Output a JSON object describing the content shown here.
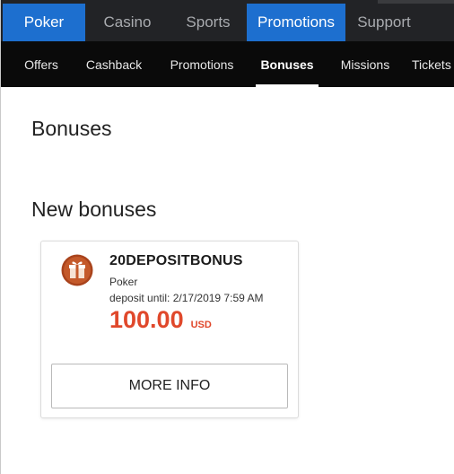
{
  "topnav": {
    "tabs": [
      {
        "label": "Poker",
        "active": true
      },
      {
        "label": "Casino",
        "active": false
      },
      {
        "label": "Sports",
        "active": false
      },
      {
        "label": "Promotions",
        "active": true
      },
      {
        "label": "Support",
        "active": false
      }
    ]
  },
  "subnav": {
    "items": [
      {
        "label": "Offers",
        "active": false
      },
      {
        "label": "Cashback",
        "active": false
      },
      {
        "label": "Promotions",
        "active": false
      },
      {
        "label": "Bonuses",
        "active": true
      },
      {
        "label": "Missions",
        "active": false
      },
      {
        "label": "Tickets",
        "active": false
      }
    ]
  },
  "page": {
    "title": "Bonuses",
    "section_title": "New bonuses"
  },
  "bonus": {
    "icon": "gift-icon",
    "code": "20DEPOSITBONUS",
    "product": "Poker",
    "deposit_until": "deposit until: 2/17/2019 7:59 AM",
    "amount": "100.00",
    "currency": "USD",
    "more_label": "MORE INFO"
  },
  "colors": {
    "accent_blue": "#1d6fcf",
    "amount_red": "#e0482b",
    "topnav_bg": "#222326",
    "subnav_bg": "#0a0a0a"
  }
}
